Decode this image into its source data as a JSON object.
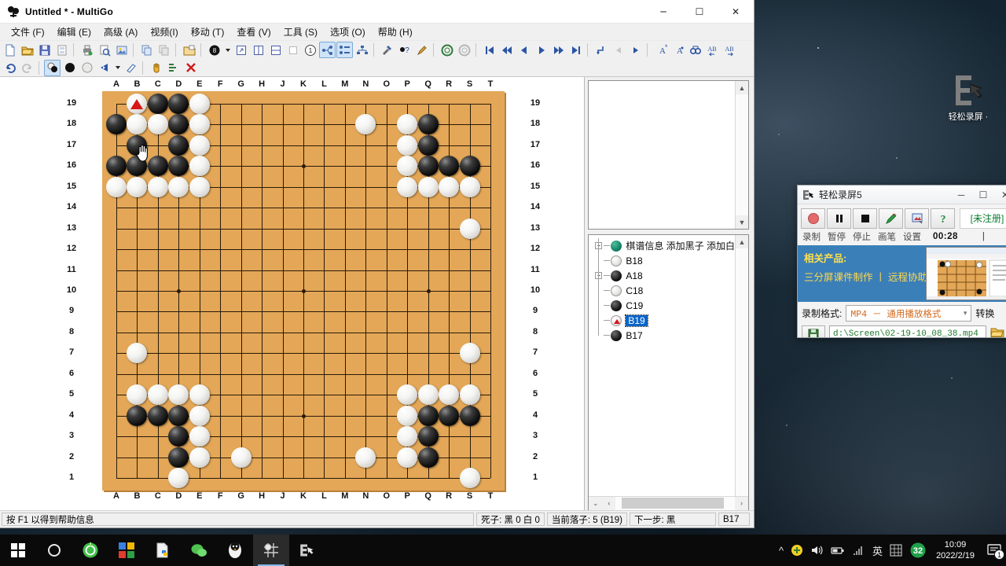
{
  "window": {
    "title": "Untitled  * - MultiGo",
    "minimize": "─",
    "maximize": "☐",
    "close": "✕",
    "app_icon": "multigo-stones-icon"
  },
  "menubar": [
    {
      "label": "文件 (F)",
      "name": "menu-file"
    },
    {
      "label": "编辑 (E)",
      "name": "menu-edit"
    },
    {
      "label": "高级 (A)",
      "name": "menu-advanced"
    },
    {
      "label": "视频(I)",
      "name": "menu-video"
    },
    {
      "label": "移动 (T)",
      "name": "menu-move"
    },
    {
      "label": "查看 (V)",
      "name": "menu-view"
    },
    {
      "label": "工具 (S)",
      "name": "menu-tools"
    },
    {
      "label": "选项 (O)",
      "name": "menu-options"
    },
    {
      "label": "帮助 (H)",
      "name": "menu-help"
    }
  ],
  "board": {
    "columns": [
      "A",
      "B",
      "C",
      "D",
      "E",
      "F",
      "G",
      "H",
      "J",
      "K",
      "L",
      "M",
      "N",
      "O",
      "P",
      "Q",
      "R",
      "S",
      "T"
    ],
    "rows": [
      19,
      18,
      17,
      16,
      15,
      14,
      13,
      12,
      11,
      10,
      9,
      8,
      7,
      6,
      5,
      4,
      3,
      2,
      1
    ],
    "size": 19,
    "wood_color": "#e3a757",
    "line_color": "#2a1a08",
    "star_points": [
      [
        3,
        3
      ],
      [
        9,
        3
      ],
      [
        15,
        3
      ],
      [
        3,
        9
      ],
      [
        9,
        9
      ],
      [
        15,
        9
      ],
      [
        3,
        15
      ],
      [
        9,
        15
      ],
      [
        15,
        15
      ]
    ],
    "marked_point": "B19",
    "marker_color": "#d81616",
    "cursor_at": "B17",
    "stones": [
      {
        "p": "B19",
        "c": "w"
      },
      {
        "p": "C19",
        "c": "b"
      },
      {
        "p": "D19",
        "c": "b"
      },
      {
        "p": "E19",
        "c": "w"
      },
      {
        "p": "A18",
        "c": "b"
      },
      {
        "p": "B18",
        "c": "w"
      },
      {
        "p": "C18",
        "c": "w"
      },
      {
        "p": "D18",
        "c": "b"
      },
      {
        "p": "E18",
        "c": "w"
      },
      {
        "p": "B17",
        "c": "b"
      },
      {
        "p": "D17",
        "c": "b"
      },
      {
        "p": "E17",
        "c": "w"
      },
      {
        "p": "A16",
        "c": "b"
      },
      {
        "p": "B16",
        "c": "b"
      },
      {
        "p": "C16",
        "c": "b"
      },
      {
        "p": "D16",
        "c": "b"
      },
      {
        "p": "E16",
        "c": "w"
      },
      {
        "p": "A15",
        "c": "w"
      },
      {
        "p": "B15",
        "c": "w"
      },
      {
        "p": "C15",
        "c": "w"
      },
      {
        "p": "D15",
        "c": "w"
      },
      {
        "p": "E15",
        "c": "w"
      },
      {
        "p": "N18",
        "c": "w"
      },
      {
        "p": "P18",
        "c": "w"
      },
      {
        "p": "Q18",
        "c": "b"
      },
      {
        "p": "P17",
        "c": "w"
      },
      {
        "p": "Q17",
        "c": "b"
      },
      {
        "p": "P16",
        "c": "w"
      },
      {
        "p": "Q16",
        "c": "b"
      },
      {
        "p": "R16",
        "c": "b"
      },
      {
        "p": "S16",
        "c": "b"
      },
      {
        "p": "P15",
        "c": "w"
      },
      {
        "p": "Q15",
        "c": "w"
      },
      {
        "p": "R15",
        "c": "w"
      },
      {
        "p": "S15",
        "c": "w"
      },
      {
        "p": "S13",
        "c": "w"
      },
      {
        "p": "B7",
        "c": "w"
      },
      {
        "p": "S7",
        "c": "w"
      },
      {
        "p": "B5",
        "c": "w"
      },
      {
        "p": "C5",
        "c": "w"
      },
      {
        "p": "D5",
        "c": "w"
      },
      {
        "p": "E5",
        "c": "w"
      },
      {
        "p": "P5",
        "c": "w"
      },
      {
        "p": "Q5",
        "c": "w"
      },
      {
        "p": "R5",
        "c": "w"
      },
      {
        "p": "S5",
        "c": "w"
      },
      {
        "p": "B4",
        "c": "b"
      },
      {
        "p": "C4",
        "c": "b"
      },
      {
        "p": "D4",
        "c": "b"
      },
      {
        "p": "E4",
        "c": "w"
      },
      {
        "p": "P4",
        "c": "w"
      },
      {
        "p": "Q4",
        "c": "b"
      },
      {
        "p": "R4",
        "c": "b"
      },
      {
        "p": "S4",
        "c": "b"
      },
      {
        "p": "D3",
        "c": "b"
      },
      {
        "p": "E3",
        "c": "w"
      },
      {
        "p": "P3",
        "c": "w"
      },
      {
        "p": "Q3",
        "c": "b"
      },
      {
        "p": "D2",
        "c": "b"
      },
      {
        "p": "E2",
        "c": "w"
      },
      {
        "p": "G2",
        "c": "w"
      },
      {
        "p": "N2",
        "c": "w"
      },
      {
        "p": "P2",
        "c": "w"
      },
      {
        "p": "Q2",
        "c": "b"
      },
      {
        "p": "D1",
        "c": "w"
      },
      {
        "p": "S1",
        "c": "w"
      }
    ]
  },
  "comment_panel": {
    "text": "",
    "scroll_up": "▲",
    "scroll_down": "▼"
  },
  "tree": {
    "root_label": "棋谱信息 添加黑子 添加白",
    "nodes": [
      {
        "label": "B18",
        "stone": "w",
        "expander": false,
        "name": "tree-node-b18"
      },
      {
        "label": "A18",
        "stone": "b",
        "expander": true,
        "name": "tree-node-a18"
      },
      {
        "label": "C18",
        "stone": "w",
        "expander": false,
        "name": "tree-node-c18"
      },
      {
        "label": "C19",
        "stone": "b",
        "expander": false,
        "name": "tree-node-c19"
      },
      {
        "label": "B19",
        "stone": "marked",
        "expander": false,
        "selected": true,
        "name": "tree-node-b19"
      },
      {
        "label": "B17",
        "stone": "b",
        "expander": false,
        "name": "tree-node-b17"
      }
    ],
    "scroll_left": "‹",
    "scroll_right": "›",
    "scroll_down": "⌄"
  },
  "statusbar": {
    "hint": "按 F1 以得到帮助信息",
    "captured": "死子: 黑 0 白 0",
    "current_move": "当前落子: 5 (B19)",
    "next_move": "下一步: 黑",
    "last_node": "B17"
  },
  "recorder": {
    "title": "轻松录屏5",
    "minimize": "─",
    "maximize": "☐",
    "close": "✕",
    "buttons": [
      {
        "label": "录制",
        "name": "record-button",
        "icon": "record-dot-icon"
      },
      {
        "label": "暂停",
        "name": "pause-button",
        "icon": "pause-icon"
      },
      {
        "label": "停止",
        "name": "stop-button",
        "icon": "stop-square-icon"
      },
      {
        "label": "画笔",
        "name": "pen-button",
        "icon": "pen-icon"
      },
      {
        "label": "设置",
        "name": "settings-button",
        "icon": "window-settings-icon"
      }
    ],
    "help_icon": "question-mark-icon",
    "registration": "[未注册]",
    "timer": "00:28",
    "ad": {
      "line1": "相关产品:",
      "line2": "三分屏课件制作  丨  远程协助控"
    },
    "format_label": "录制格式:",
    "format_value": "MP4 － 通用播放格式",
    "convert_label": "转换",
    "save_path": "d:\\Screen\\02-19-10_08_38.mp4"
  },
  "desktop": {
    "icon_label": "轻松录屏 ·",
    "icon_name": "recorder-shortcut-icon"
  },
  "taskbar": {
    "items": [
      {
        "name": "start-button",
        "icon": "windows-logo-icon"
      },
      {
        "name": "cortana-button",
        "icon": "circle-search-icon"
      },
      {
        "name": "browser-360-button",
        "icon": "green-browser-icon"
      },
      {
        "name": "store-button",
        "icon": "microsoft-store-icon"
      },
      {
        "name": "editor-button",
        "icon": "document-python-icon"
      },
      {
        "name": "wechat-button",
        "icon": "wechat-icon"
      },
      {
        "name": "qq-button",
        "icon": "qq-penguin-icon"
      },
      {
        "name": "multigo-taskbar-button",
        "icon": "multigo-board-icon",
        "active": true
      },
      {
        "name": "recorder-taskbar-button",
        "icon": "recorder-icon"
      }
    ],
    "tray": [
      {
        "name": "tray-expand-icon",
        "glyph": "∧"
      },
      {
        "name": "tray-update-icon",
        "glyph": "⬤"
      },
      {
        "name": "volume-icon",
        "glyph": "🔊"
      },
      {
        "name": "battery-icon",
        "glyph": "▭"
      },
      {
        "name": "wifi-icon",
        "glyph": "◠"
      },
      {
        "name": "ime-language-icon",
        "glyph": "英"
      },
      {
        "name": "ime-keyboard-icon",
        "glyph": "⌨"
      },
      {
        "name": "security-score-icon",
        "glyph": "32"
      }
    ],
    "clock_time": "10:09",
    "clock_date": "2022/2/19",
    "notification_count": "1"
  }
}
